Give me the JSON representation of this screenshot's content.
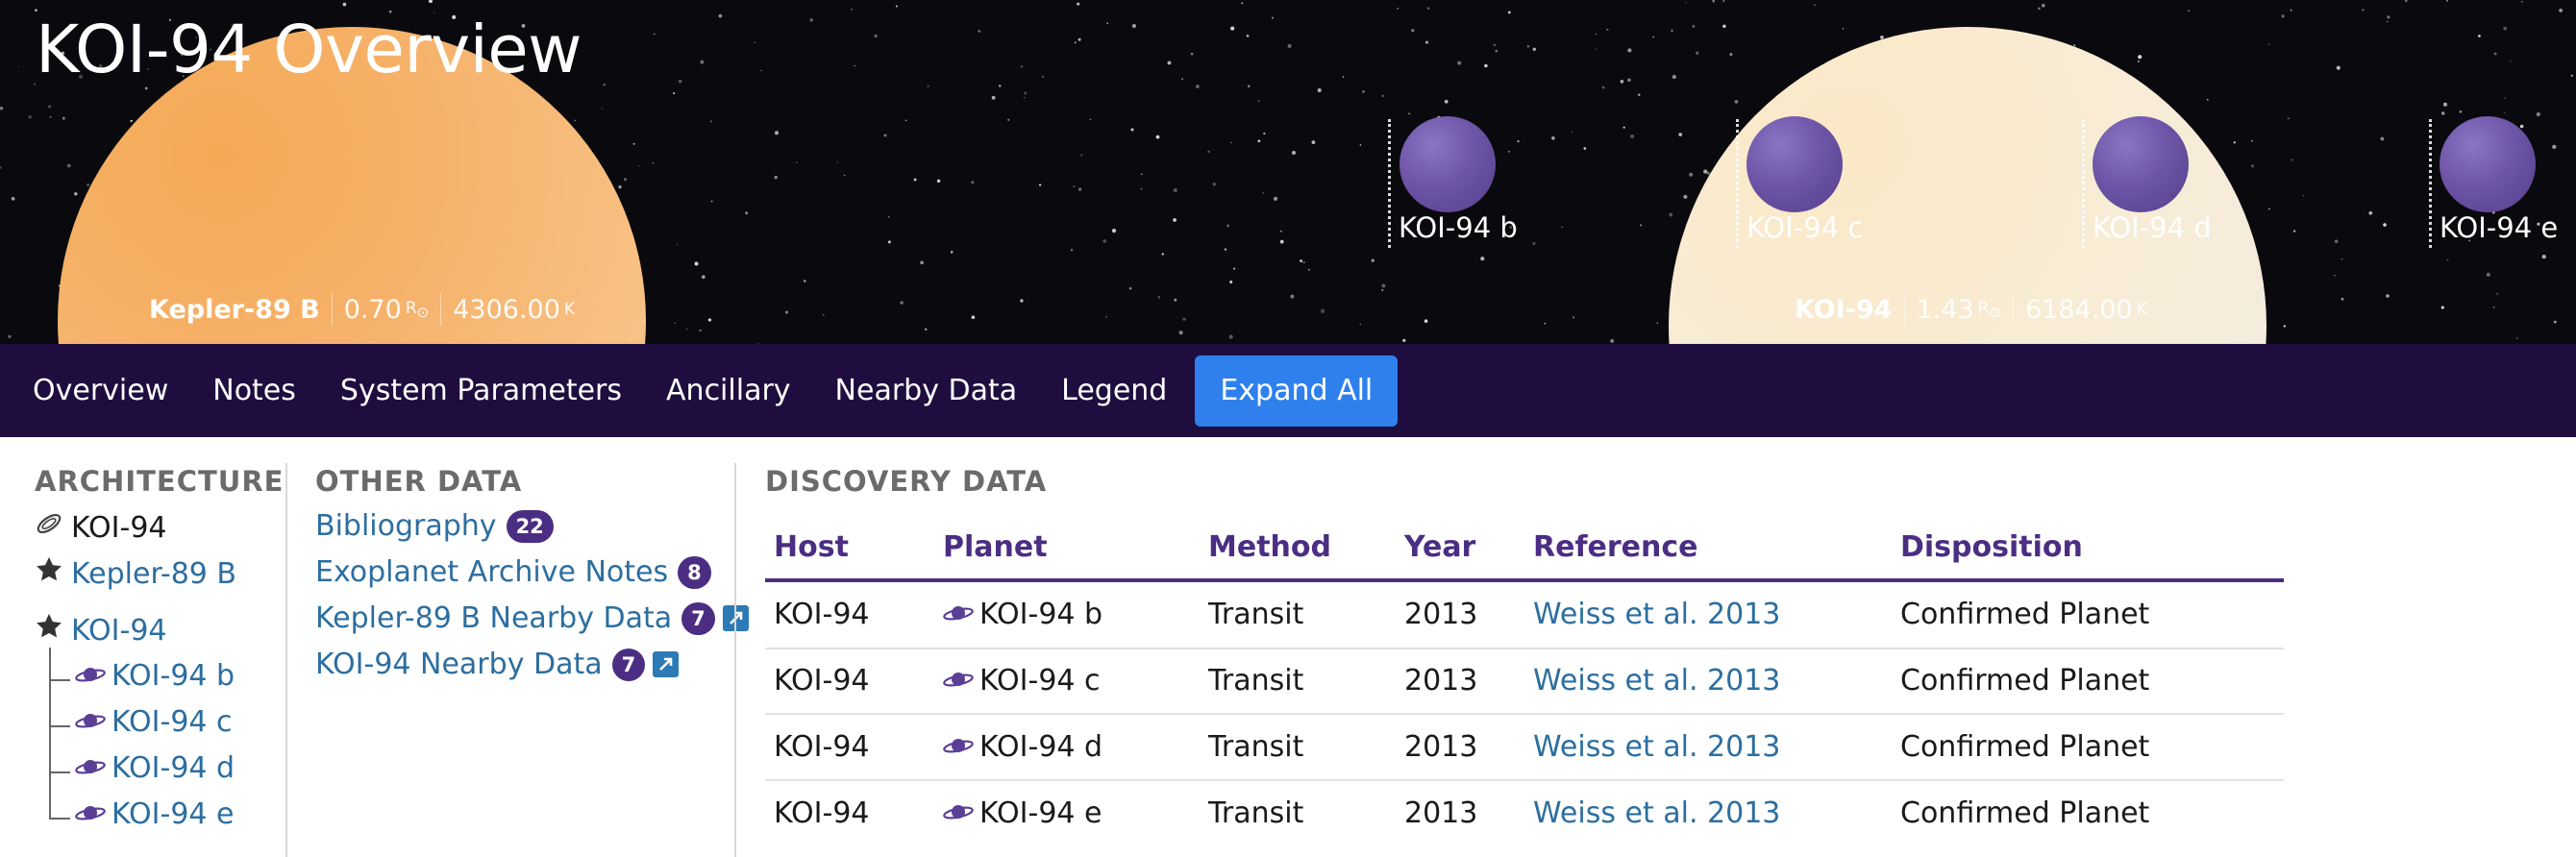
{
  "page_title": "KOI-94 Overview",
  "hero": {
    "stars": [
      {
        "name": "Kepler-89 B",
        "radius": "0.70",
        "radius_unit": "R",
        "radius_sub": "⊙",
        "temp": "4306.00",
        "temp_unit": "K"
      },
      {
        "name": "KOI-94",
        "radius": "1.43",
        "radius_unit": "R",
        "radius_sub": "⊙",
        "temp": "6184.00",
        "temp_unit": "K"
      }
    ],
    "planets": [
      "KOI-94 b",
      "KOI-94 c",
      "KOI-94 d",
      "KOI-94 e"
    ]
  },
  "nav": {
    "items": [
      "Overview",
      "Notes",
      "System Parameters",
      "Ancillary",
      "Nearby Data",
      "Legend"
    ],
    "button": "Expand All"
  },
  "architecture": {
    "heading": "ARCHITECTURE",
    "system": "KOI-94",
    "stars": [
      "Kepler-89 B",
      "KOI-94"
    ],
    "planets": [
      "KOI-94 b",
      "KOI-94 c",
      "KOI-94 d",
      "KOI-94 e"
    ]
  },
  "other_data": {
    "heading": "OTHER DATA",
    "items": [
      {
        "label": "Bibliography",
        "count": "22"
      },
      {
        "label": "Exoplanet Archive Notes",
        "count": "8"
      },
      {
        "label": "Kepler-89 B Nearby Data",
        "count": "7"
      },
      {
        "label": "KOI-94 Nearby Data",
        "count": "7"
      }
    ]
  },
  "discovery": {
    "heading": "DISCOVERY DATA",
    "columns": [
      "Host",
      "Planet",
      "Method",
      "Year",
      "Reference",
      "Disposition"
    ],
    "rows": [
      [
        "KOI-94",
        "KOI-94 b",
        "Transit",
        "2013",
        "Weiss et al. 2013",
        "Confirmed Planet"
      ],
      [
        "KOI-94",
        "KOI-94 c",
        "Transit",
        "2013",
        "Weiss et al. 2013",
        "Confirmed Planet"
      ],
      [
        "KOI-94",
        "KOI-94 d",
        "Transit",
        "2013",
        "Weiss et al. 2013",
        "Confirmed Planet"
      ],
      [
        "KOI-94",
        "KOI-94 e",
        "Transit",
        "2013",
        "Weiss et al. 2013",
        "Confirmed Planet"
      ]
    ]
  },
  "colors": {
    "nav_bg": "#1e0d3e",
    "accent_purple": "#4b2e83",
    "link": "#2c6ea0",
    "button": "#2f80ed",
    "star_kepler": "#f6b26b",
    "star_koi": "#f8ecd6",
    "planet": "#6e55a8"
  },
  "icons": {
    "system": "orbit-icon",
    "star": "star-icon",
    "planet": "planet-icon",
    "external": "external-link-icon"
  }
}
